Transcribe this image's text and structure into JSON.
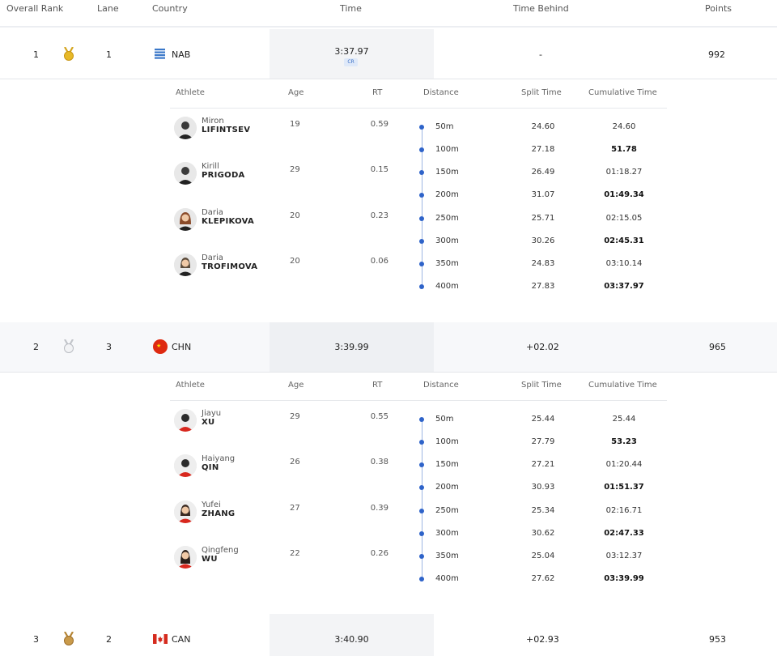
{
  "header": {
    "overall_rank": "Overall Rank",
    "lane": "Lane",
    "country": "Country",
    "time": "Time",
    "time_behind": "Time Behind",
    "points": "Points"
  },
  "sub_header": {
    "athlete": "Athlete",
    "age": "Age",
    "rt": "RT",
    "distance": "Distance",
    "split_time": "Split Time",
    "cumulative_time": "Cumulative Time"
  },
  "colors": {
    "gold": "#d4a520",
    "silver": "#b9bcc2",
    "bronze": "#b58535",
    "accent": "#2e63c9"
  },
  "results": [
    {
      "rank": "1",
      "lane": "1",
      "country": "NAB",
      "time": "3:37.97",
      "badge": "CR",
      "behind": "-",
      "points": "992",
      "medal": "gold-medal-icon",
      "athletes": [
        {
          "first": "Miron",
          "last": "LIFINTSEV",
          "age": "19",
          "rt": "0.59"
        },
        {
          "first": "Kirill",
          "last": "PRIGODA",
          "age": "29",
          "rt": "0.15"
        },
        {
          "first": "Daria",
          "last": "KLEPIKOVA",
          "age": "20",
          "rt": "0.23"
        },
        {
          "first": "Daria",
          "last": "TROFIMOVA",
          "age": "20",
          "rt": "0.06"
        }
      ],
      "splits": [
        {
          "distance": "50m",
          "split": "24.60",
          "cumulative": "24.60"
        },
        {
          "distance": "100m",
          "split": "27.18",
          "cumulative": "51.78"
        },
        {
          "distance": "150m",
          "split": "26.49",
          "cumulative": "01:18.27"
        },
        {
          "distance": "200m",
          "split": "31.07",
          "cumulative": "01:49.34"
        },
        {
          "distance": "250m",
          "split": "25.71",
          "cumulative": "02:15.05"
        },
        {
          "distance": "300m",
          "split": "30.26",
          "cumulative": "02:45.31"
        },
        {
          "distance": "350m",
          "split": "24.83",
          "cumulative": "03:10.14"
        },
        {
          "distance": "400m",
          "split": "27.83",
          "cumulative": "03:37.97"
        }
      ]
    },
    {
      "rank": "2",
      "lane": "3",
      "country": "CHN",
      "time": "3:39.99",
      "behind": "+02.02",
      "points": "965",
      "medal": "silver-medal-icon",
      "athletes": [
        {
          "first": "Jiayu",
          "last": "XU",
          "age": "29",
          "rt": "0.55"
        },
        {
          "first": "Haiyang",
          "last": "QIN",
          "age": "26",
          "rt": "0.38"
        },
        {
          "first": "Yufei",
          "last": "ZHANG",
          "age": "27",
          "rt": "0.39"
        },
        {
          "first": "Qingfeng",
          "last": "WU",
          "age": "22",
          "rt": "0.26"
        }
      ],
      "splits": [
        {
          "distance": "50m",
          "split": "25.44",
          "cumulative": "25.44"
        },
        {
          "distance": "100m",
          "split": "27.79",
          "cumulative": "53.23"
        },
        {
          "distance": "150m",
          "split": "27.21",
          "cumulative": "01:20.44"
        },
        {
          "distance": "200m",
          "split": "30.93",
          "cumulative": "01:51.37"
        },
        {
          "distance": "250m",
          "split": "25.34",
          "cumulative": "02:16.71"
        },
        {
          "distance": "300m",
          "split": "30.62",
          "cumulative": "02:47.33"
        },
        {
          "distance": "350m",
          "split": "25.04",
          "cumulative": "03:12.37"
        },
        {
          "distance": "400m",
          "split": "27.62",
          "cumulative": "03:39.99"
        }
      ]
    },
    {
      "rank": "3",
      "lane": "2",
      "country": "CAN",
      "time": "3:40.90",
      "behind": "+02.93",
      "points": "953",
      "medal": "bronze-medal-icon"
    }
  ]
}
